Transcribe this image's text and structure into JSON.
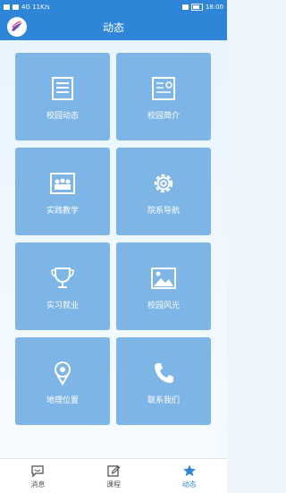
{
  "status_bar": {
    "left_text": "4G 11K/s",
    "time": "18:00"
  },
  "header": {
    "title": "动态"
  },
  "tiles": [
    {
      "label": "校园动态",
      "icon": "news-icon"
    },
    {
      "label": "校园简介",
      "icon": "certificate-icon"
    },
    {
      "label": "实践教学",
      "icon": "group-photo-icon"
    },
    {
      "label": "院系导航",
      "icon": "gear-icon"
    },
    {
      "label": "实习就业",
      "icon": "trophy-icon"
    },
    {
      "label": "校园风光",
      "icon": "landscape-icon"
    },
    {
      "label": "地理位置",
      "icon": "location-pin-icon"
    },
    {
      "label": "联系我们",
      "icon": "phone-icon"
    }
  ],
  "tabbar": {
    "items": [
      {
        "label": "消息",
        "icon": "message-icon",
        "active": false
      },
      {
        "label": "课程",
        "icon": "edit-icon",
        "active": false
      },
      {
        "label": "动态",
        "icon": "star-icon",
        "active": true
      }
    ]
  },
  "colors": {
    "primary": "#2f86d8",
    "tile": "#7db6e6",
    "background": "#eef6fd"
  }
}
